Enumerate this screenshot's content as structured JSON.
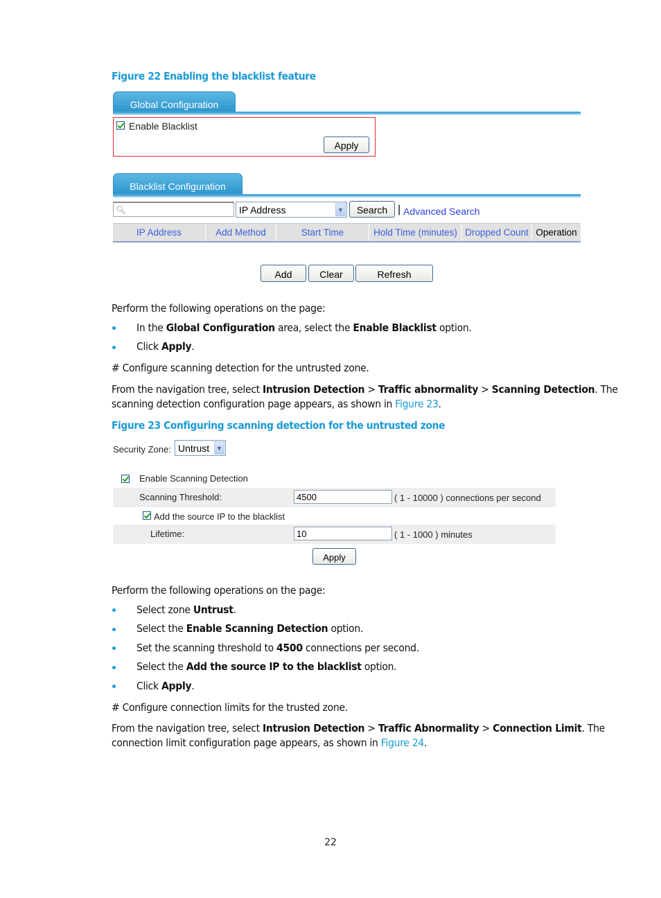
{
  "figure22": {
    "caption": "Figure 22 Enabling the blacklist feature",
    "global_tab": "Global Configuration",
    "enable_blacklist_label": "Enable Blacklist",
    "enable_blacklist_checked": true,
    "apply_label": "Apply",
    "blacklist_tab": "Blacklist Configuration",
    "search_input_value": "",
    "search_field_select": "IP Address",
    "search_button": "Search",
    "separator": "|",
    "advanced_search": "Advanced Search",
    "columns": [
      "IP Address",
      "Add Method",
      "Start Time",
      "Hold Time (minutes)",
      "Dropped Count",
      "Operation"
    ],
    "buttons": [
      "Add",
      "Clear",
      "Refresh"
    ]
  },
  "text1": {
    "intro": "Perform the following operations on the page:",
    "bullets": [
      {
        "pre": "In the ",
        "b1": "Global Configuration",
        "mid": " area, select the ",
        "b2": "Enable Blacklist",
        "post": " option."
      },
      {
        "pre": "Click ",
        "b1": "Apply",
        "post": "."
      }
    ],
    "comment": "# Configure scanning detection for the untrusted zone.",
    "nav_pre": "From the navigation tree, select ",
    "nav_b1": "Intrusion Detection",
    "nav_sep1": " > ",
    "nav_b2": "Traffic abnormality",
    "nav_sep2": " > ",
    "nav_b3": "Scanning Detection",
    "nav_post": ". The",
    "nav_line2_pre": "scanning detection configuration page appears, as shown in ",
    "nav_line2_link": "Figure 23",
    "nav_line2_post": "."
  },
  "figure23": {
    "caption": "Figure 23 Configuring scanning detection for the untrusted zone",
    "security_zone_label": "Security Zone:",
    "security_zone_value": "Untrust",
    "enable_scanning_label": "Enable Scanning Detection",
    "enable_scanning_checked": true,
    "threshold_label": "Scanning Threshold:",
    "threshold_value": "4500",
    "threshold_hint": "( 1 - 10000 ) connections per second",
    "add_source_label": "Add the source IP to the blacklist",
    "add_source_checked": true,
    "lifetime_label": "Lifetime:",
    "lifetime_value": "10",
    "lifetime_hint": "( 1 - 1000 ) minutes",
    "apply_label": "Apply"
  },
  "text2": {
    "intro": "Perform the following operations on the page:",
    "bullets": [
      {
        "pre": "Select zone ",
        "b1": "Untrust",
        "post": "."
      },
      {
        "pre": "Select the ",
        "b1": "Enable Scanning Detection",
        "post": " option."
      },
      {
        "pre": "Set the scanning threshold to ",
        "b1": "4500",
        "post": " connections per second."
      },
      {
        "pre": "Select the ",
        "b1": "Add the source IP to the blacklist",
        "post": " option."
      },
      {
        "pre": "Click ",
        "b1": "Apply",
        "post": "."
      }
    ],
    "comment": "# Configure connection limits for the trusted zone.",
    "nav_pre": "From the navigation tree, select ",
    "nav_b1": "Intrusion Detection",
    "nav_sep1": " > ",
    "nav_b2": "Traffic Abnormality",
    "nav_sep2": " > ",
    "nav_b3": "Connection Limit",
    "nav_post": ". The",
    "nav_line2_pre": "connection limit configuration page appears, as shown in ",
    "nav_line2_link": "Figure 24",
    "nav_line2_post": "."
  },
  "page_number": "22",
  "colors": {
    "accent": "#1b9ad6",
    "tab": "#3a9fd3",
    "highlight_border": "#e8262a",
    "column_header_text": "#3b5ed9"
  }
}
